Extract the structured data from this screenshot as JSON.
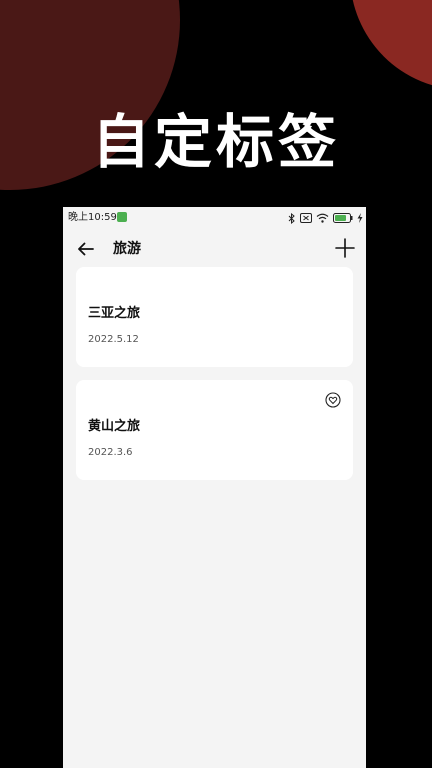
{
  "promo": {
    "headline": "自定标签"
  },
  "status_bar": {
    "time": "晚上10:59",
    "icons": [
      "app-notification-icon",
      "bluetooth-icon",
      "sim-icon",
      "wifi-icon",
      "battery-icon",
      "charging-icon"
    ]
  },
  "nav": {
    "title": "旅游",
    "back_icon": "arrow-left-icon",
    "add_icon": "plus-icon"
  },
  "cards": [
    {
      "title": "三亚之旅",
      "date": "2022.5.12",
      "favorite": false
    },
    {
      "title": "黄山之旅",
      "date": "2022.3.6",
      "favorite": true
    }
  ],
  "colors": {
    "background": "#000000",
    "accent_dark": "#4a1816",
    "accent_red": "#8a2822",
    "screen_bg": "#f4f4f4",
    "card_bg": "#ffffff",
    "battery_green": "#4caf50"
  }
}
